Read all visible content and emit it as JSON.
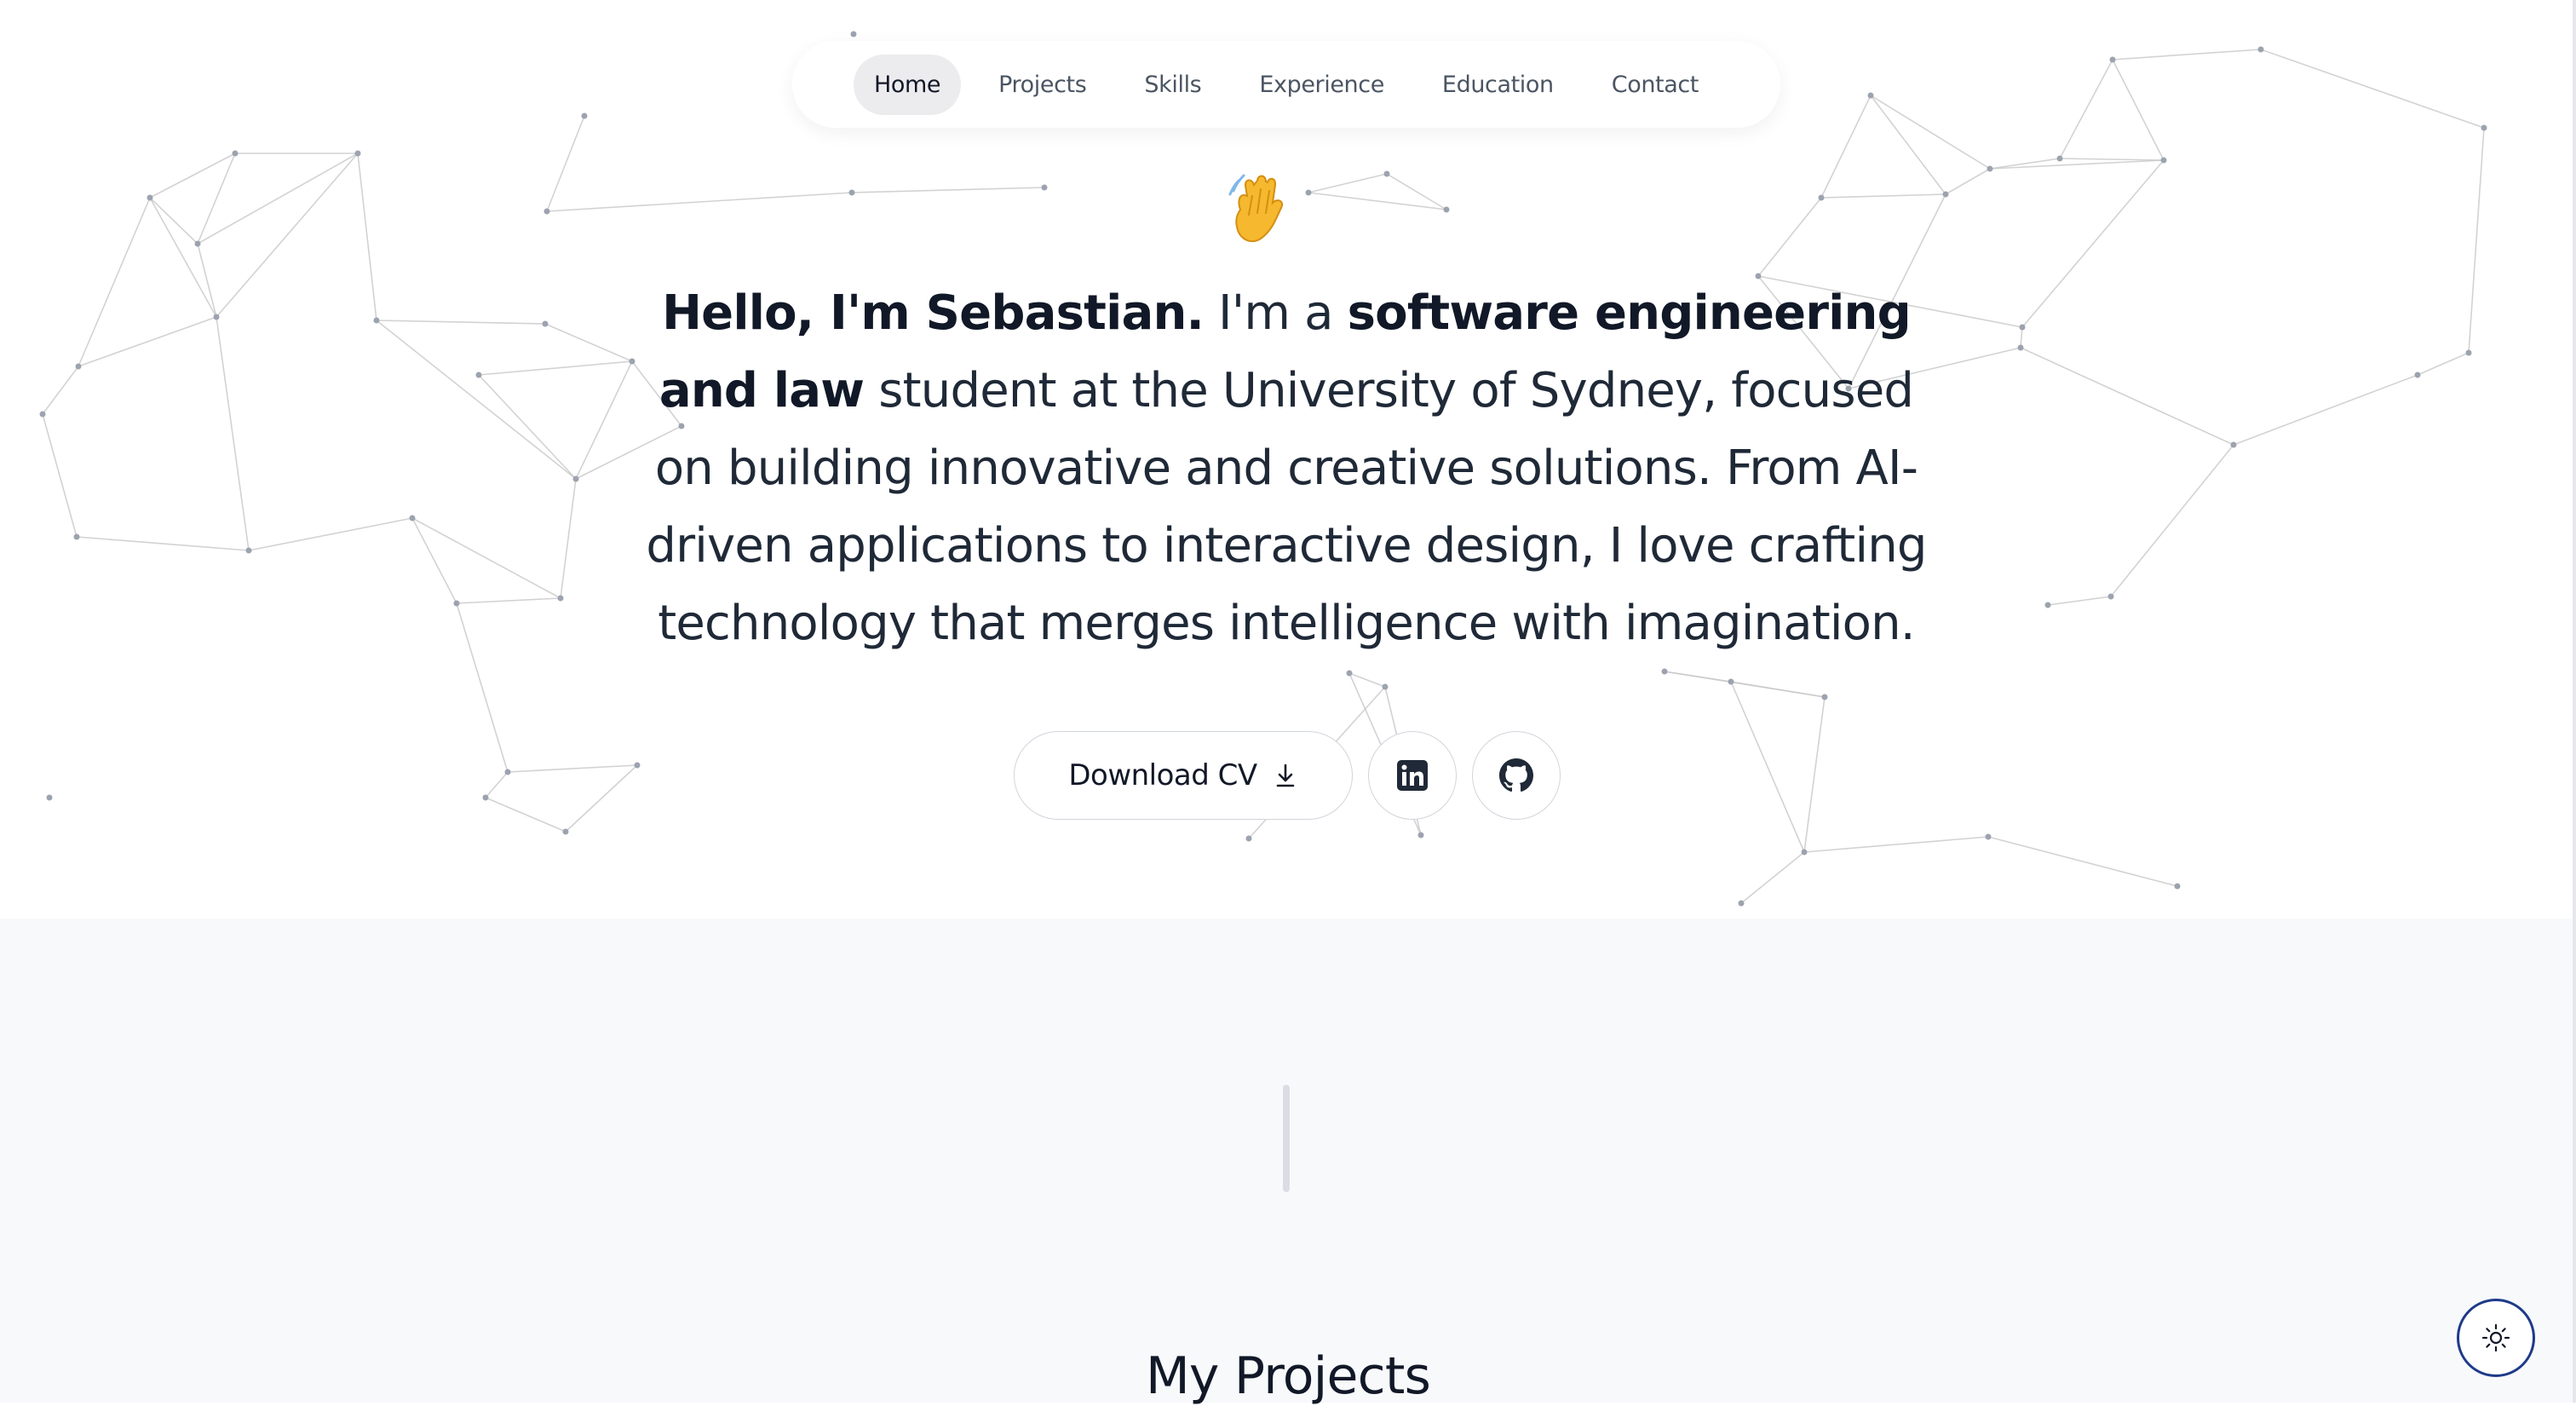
{
  "nav": {
    "items": [
      "Home",
      "Projects",
      "Skills",
      "Experience",
      "Education",
      "Contact"
    ],
    "active": "Home"
  },
  "hero": {
    "emoji": "👋",
    "intro": {
      "name_bold": "Hello, I'm Sebastian.",
      "text1": " I'm a ",
      "degree_bold": "software engineering and law",
      "text2": " student at the University of Sydney, focused on building innovative and creative solutions. From AI-driven applications to interactive design, I love crafting technology that merges intelligence with imagination."
    },
    "download_label": "Download CV",
    "icons": {
      "download": "download-icon",
      "linkedin": "linkedin-icon",
      "github": "github-icon"
    }
  },
  "projects_section": {
    "title": "My Projects"
  },
  "theme_toggle": {
    "icon": "sun-icon"
  },
  "colors": {
    "page_bg": "#ffffff",
    "section_bg": "#f8f9fb",
    "text": "#111827",
    "nav_active_bg": "#ececee",
    "network_line": "#c8c8c8",
    "toggle_border": "#1e3a8a"
  }
}
